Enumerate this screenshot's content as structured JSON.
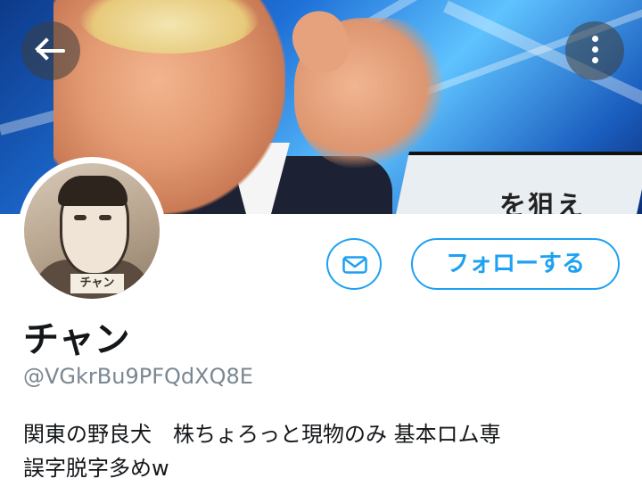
{
  "profile": {
    "display_name": "チャン",
    "handle": "@VGkrBu9PFQdXQ8E",
    "bio_lines": [
      "関東の野良犬　株ちょろっと現物のみ 基本ロム専",
      "誤字脱字多めw"
    ],
    "avatar_label": "チャン"
  },
  "banner": {
    "sign_text": "を狙え"
  },
  "actions": {
    "follow_label": "フォローする"
  },
  "icons": {
    "back": "arrow-left-icon",
    "more": "more-vertical-icon",
    "mail": "mail-icon"
  },
  "colors": {
    "accent": "#1da1f2",
    "text": "#14171a",
    "secondary_text": "#7a8791"
  }
}
